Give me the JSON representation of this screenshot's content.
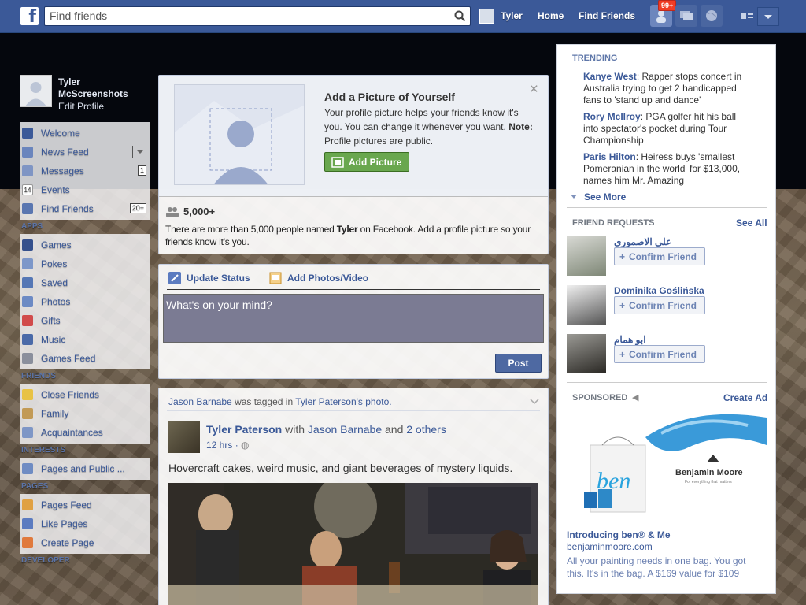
{
  "topbar": {
    "search_placeholder": "Find friends",
    "user_name": "Tyler",
    "nav_home": "Home",
    "nav_find_friends": "Find Friends",
    "friend_requests_badge": "99+"
  },
  "left": {
    "profile_name": "Tyler McScreenshots",
    "edit_profile": "Edit Profile",
    "main_items": [
      {
        "label": "Welcome",
        "count": ""
      },
      {
        "label": "News Feed",
        "count": ""
      },
      {
        "label": "Messages",
        "count": "1"
      },
      {
        "label": "Events",
        "count": ""
      },
      {
        "label": "Find Friends",
        "count": "20+"
      }
    ],
    "apps_heading": "APPS",
    "apps": [
      "Games",
      "Pokes",
      "Saved",
      "Photos",
      "Gifts",
      "Music",
      "Games Feed"
    ],
    "friends_heading": "FRIENDS",
    "friends": [
      "Close Friends",
      "Family",
      "Acquaintances"
    ],
    "interests_heading": "INTERESTS",
    "interests": [
      "Pages and Public ..."
    ],
    "pages_heading": "PAGES",
    "pages": [
      "Pages Feed",
      "Like Pages",
      "Create Page"
    ],
    "developer_heading": "DEVELOPER"
  },
  "add_picture": {
    "title": "Add a Picture of Yourself",
    "text": "Your profile picture helps your friends know it's you. You can change it whenever you want.",
    "note_label": "Note:",
    "note_text": "Profile pictures are public.",
    "button": "Add Picture",
    "count": "5,000+",
    "desc_pre": "There are more than 5,000 people named",
    "desc_name": "Tyler",
    "desc_post": "on Facebook. Add a profile picture so your friends know it's you."
  },
  "composer": {
    "update_status": "Update Status",
    "add_photos": "Add Photos/Video",
    "placeholder": "What's on your mind?",
    "post_button": "Post"
  },
  "story": {
    "tagged_user": "Jason Barnabe",
    "tagged_mid": "was tagged in",
    "tagged_target": "Tyler Paterson's photo.",
    "author": "Tyler Paterson",
    "with_text": "with",
    "with_name": "Jason Barnabe",
    "and_text": "and",
    "others": "2 others",
    "time": "12 hrs",
    "text": "Hovercraft cakes, weird music, and giant beverages of mystery liquids."
  },
  "right": {
    "trending_heading": "TRENDING",
    "trending": [
      {
        "name": "Kanye West",
        "text": ": Rapper stops concert in Australia trying to get 2 handicapped fans to 'stand up and dance'"
      },
      {
        "name": "Rory McIlroy",
        "text": ": PGA golfer hit his ball into spectator's pocket during Tour Championship"
      },
      {
        "name": "Paris Hilton",
        "text": ": Heiress buys 'smallest Pomeranian in the world' for $13,000, names him Mr. Amazing"
      }
    ],
    "see_more": "See More",
    "requests_heading": "FRIEND REQUESTS",
    "see_all": "See All",
    "requests": [
      {
        "name": "علی الاصموری",
        "button": "Confirm Friend"
      },
      {
        "name": "Dominika Goślińska",
        "button": "Confirm Friend"
      },
      {
        "name": "ابو همام",
        "button": "Confirm Friend"
      }
    ],
    "sponsored_heading": "SPONSORED",
    "create_ad": "Create Ad",
    "ad_brand": "Benjamin Moore",
    "ad_tagline": "For everything that matters",
    "ad_bag_text": "ben",
    "ad_title": "Introducing ben® & Me",
    "ad_url": "benjaminmoore.com",
    "ad_text": "All your painting needs in one bag. You got this. It's in the bag. A $169 value for $109"
  },
  "colors": {
    "brand": "#3b5998",
    "green_button": "#69a74e",
    "badge": "#f03d25"
  }
}
